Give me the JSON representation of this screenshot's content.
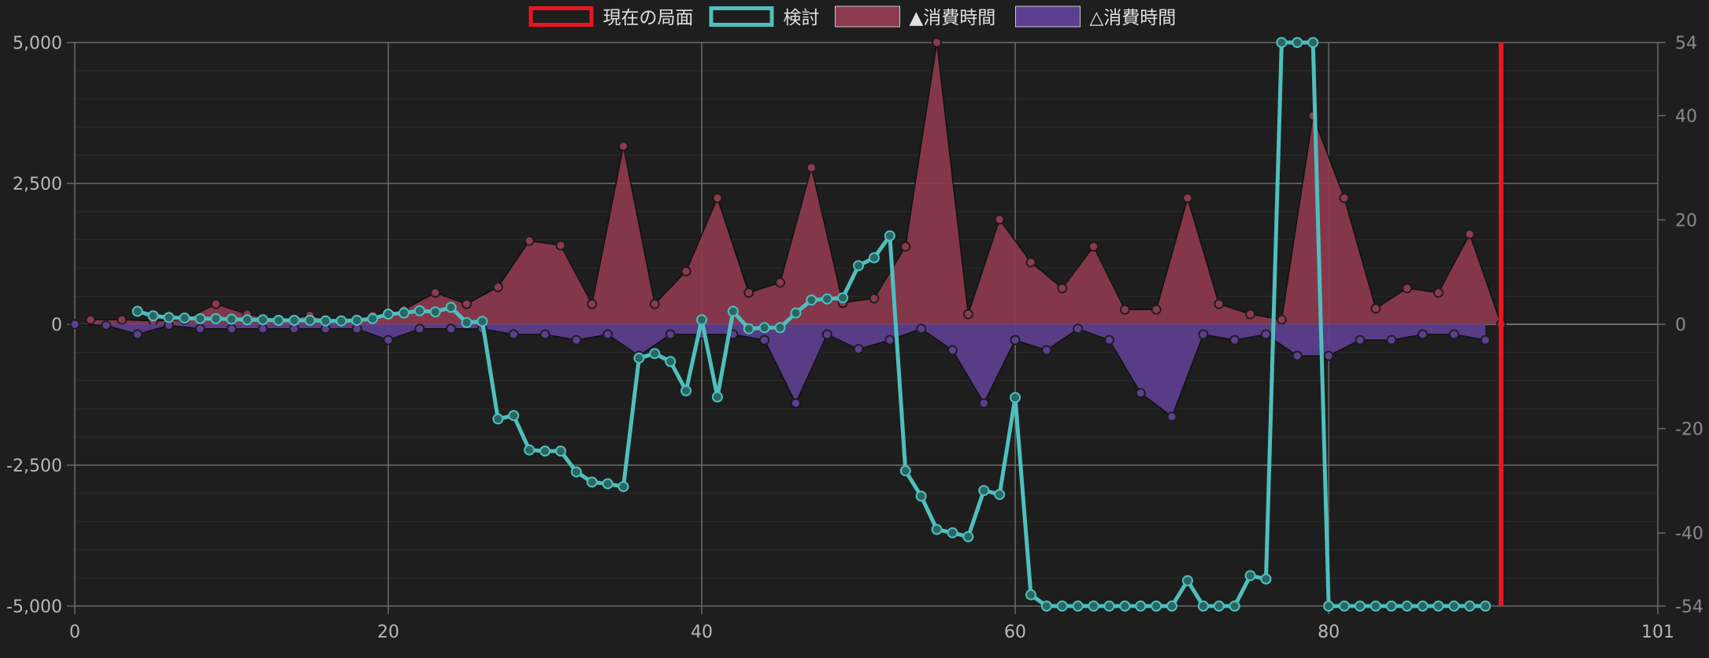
{
  "chart_data": {
    "type": "line",
    "title": "",
    "xlabel": "",
    "ylabel": "",
    "xlim": [
      0,
      101
    ],
    "ylim": [
      -5000,
      5000
    ],
    "y2lim": [
      -54,
      54
    ],
    "x_ticks": [
      0,
      20,
      40,
      60,
      80,
      101
    ],
    "y_ticks": [
      5000,
      2500,
      0,
      -2500,
      -5000
    ],
    "y_tick_labels": [
      "5,000",
      "2,500",
      "0",
      "-2,500",
      "-5,000"
    ],
    "y2_ticks": [
      54,
      40,
      20,
      0,
      -20,
      -40,
      -54
    ],
    "grid": true,
    "legend_position": "top-center",
    "current_move": 91,
    "series": [
      {
        "name": "現在の局面",
        "kind": "marker",
        "color": "#e8161f",
        "x": [
          91
        ]
      },
      {
        "name": "検討",
        "kind": "line",
        "color": "#4fbfbd",
        "x": [
          4,
          5,
          6,
          7,
          8,
          9,
          10,
          11,
          12,
          13,
          14,
          15,
          16,
          17,
          18,
          19,
          20,
          21,
          22,
          23,
          24,
          25,
          26,
          27,
          28,
          29,
          30,
          31,
          32,
          33,
          34,
          35,
          36,
          37,
          38,
          39,
          40,
          41,
          42,
          43,
          44,
          45,
          46,
          47,
          48,
          49,
          50,
          51,
          52,
          53,
          54,
          55,
          56,
          57,
          58,
          59,
          60,
          61,
          62,
          63,
          64,
          65,
          66,
          67,
          68,
          69,
          70,
          71,
          72,
          73,
          74,
          75,
          76,
          77,
          78,
          79,
          80,
          81,
          82,
          83,
          84,
          85,
          86,
          87,
          88,
          89,
          90
        ],
        "values": [
          230,
          150,
          120,
          110,
          100,
          100,
          90,
          80,
          80,
          70,
          70,
          70,
          60,
          60,
          70,
          100,
          180,
          200,
          240,
          220,
          300,
          30,
          50,
          -1680,
          -1620,
          -2230,
          -2250,
          -2250,
          -2620,
          -2800,
          -2830,
          -2880,
          -600,
          -520,
          -660,
          -1180,
          80,
          -1290,
          230,
          -80,
          -60,
          -60,
          200,
          430,
          450,
          470,
          1040,
          1180,
          1570,
          -2600,
          -3050,
          -3640,
          -3700,
          -3770,
          -2950,
          -3020,
          -1300,
          -4800,
          -5000,
          -5000,
          -5000,
          -5000,
          -5000,
          -5000,
          -5000,
          -5000,
          -5000,
          -4550,
          -5000,
          -5000,
          -5000,
          -4460,
          -4520,
          5000,
          5000,
          5000,
          -5000,
          -5000,
          -5000,
          -5000,
          -5000,
          -5000,
          -5000,
          -5000,
          -5000,
          -5000,
          -5000
        ]
      },
      {
        "name": "▲消費時間",
        "kind": "area",
        "color": "#8d3a4e",
        "x": [
          1,
          3,
          5,
          7,
          9,
          11,
          13,
          15,
          17,
          19,
          21,
          23,
          25,
          27,
          29,
          31,
          33,
          35,
          37,
          39,
          41,
          43,
          45,
          47,
          49,
          51,
          53,
          55,
          57,
          59,
          61,
          63,
          65,
          67,
          69,
          71,
          73,
          75,
          77,
          79,
          81,
          83,
          85,
          87,
          89,
          91
        ],
        "values": [
          80,
          80,
          60,
          80,
          360,
          180,
          80,
          160,
          40,
          160,
          260,
          560,
          360,
          660,
          1480,
          1400,
          360,
          3160,
          360,
          940,
          2240,
          560,
          740,
          2780,
          380,
          460,
          1380,
          5000,
          180,
          1860,
          1100,
          640,
          1380,
          260,
          260,
          2240,
          360,
          180,
          80,
          3700,
          2240,
          280,
          640,
          560,
          1600,
          0
        ]
      },
      {
        "name": "△消費時間",
        "kind": "area",
        "color": "#5d3f8f",
        "x": [
          0,
          2,
          4,
          6,
          8,
          10,
          12,
          14,
          16,
          18,
          20,
          22,
          24,
          26,
          28,
          30,
          32,
          34,
          36,
          38,
          40,
          42,
          44,
          46,
          48,
          50,
          52,
          54,
          56,
          58,
          60,
          62,
          64,
          66,
          68,
          70,
          72,
          74,
          76,
          78,
          80,
          82,
          84,
          86,
          88,
          90
        ],
        "values": [
          0,
          -20,
          -180,
          -20,
          -80,
          -80,
          -80,
          -80,
          -80,
          -80,
          -280,
          -80,
          -80,
          -80,
          -180,
          -180,
          -280,
          -180,
          -560,
          -180,
          -180,
          -180,
          -280,
          -1400,
          -180,
          -440,
          -280,
          -80,
          -460,
          -1400,
          -280,
          -460,
          -80,
          -280,
          -1220,
          -1640,
          -180,
          -280,
          -180,
          -560,
          -560,
          -280,
          -280,
          -180,
          -180,
          -280
        ]
      }
    ]
  }
}
